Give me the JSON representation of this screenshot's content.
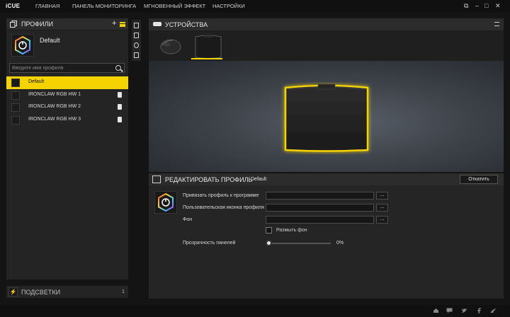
{
  "app": {
    "name": "iCUE"
  },
  "nav": {
    "home": "ГЛАВНАЯ",
    "dashboard": "ПАНЕЛЬ МОНИТОРИНГА",
    "instant": "МГНОВЕННЫЙ ЭФФЕКТ",
    "settings": "НАСТРОЙКИ"
  },
  "window_controls": {
    "restore": "⧉",
    "minimize": "–",
    "maximize": "□",
    "close": "✕"
  },
  "profiles": {
    "title": "ПРОФИЛИ",
    "add": "+",
    "current_name": "Default",
    "search_placeholder": "Введите имя профиля",
    "items": [
      {
        "label": "Default",
        "active": true
      },
      {
        "label": "IRONCLAW RGB HW 1",
        "locked": true
      },
      {
        "label": "IRONCLAW RGB HW 2",
        "locked": true
      },
      {
        "label": "IRONCLAW RGB HW 3",
        "locked": true
      }
    ]
  },
  "lightings": {
    "title": "ПОДСВЕТКИ",
    "count": "1"
  },
  "devices": {
    "title": "УСТРОЙСТВА",
    "items": [
      "mouse",
      "mousepad"
    ],
    "selected": "mousepad"
  },
  "edit_profile": {
    "title": "РЕДАКТИРОВАТЬ ПРОФИЛЬ",
    "profile_name": "Default",
    "revert": "Откатить",
    "link_program": "Привязать профиль к программе",
    "custom_icon": "Пользовательская иконка профиля",
    "background": "Фон",
    "browse": "...",
    "blur_bg": "Размыть фон",
    "panel_transparency": "Прозрачность панелей",
    "transparency_value": "0%"
  },
  "colors": {
    "accent": "#f5d300",
    "bg": "#141414",
    "panel": "#242424"
  }
}
